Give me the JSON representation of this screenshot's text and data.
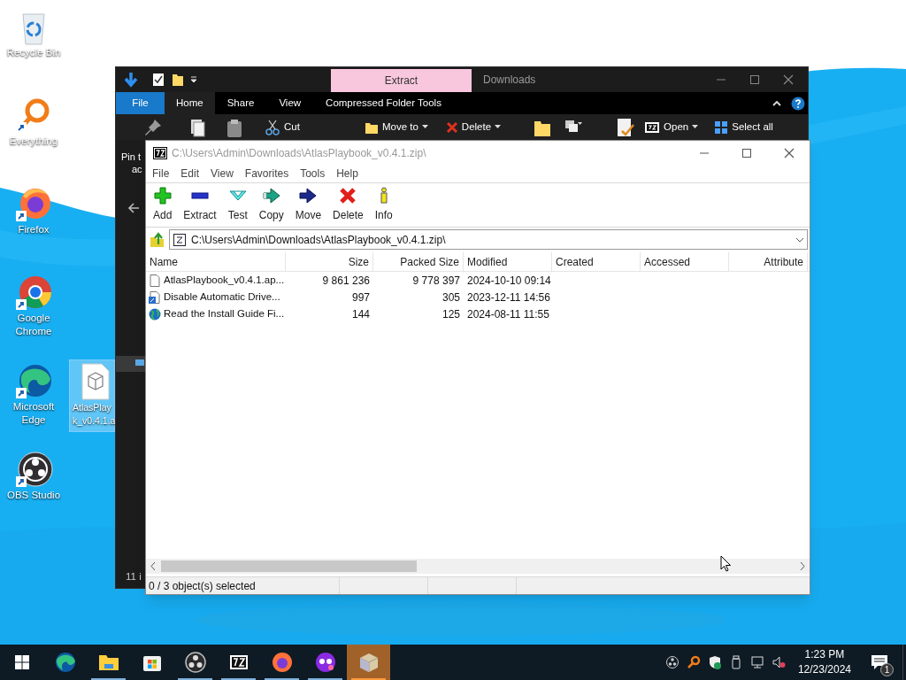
{
  "desktop": {
    "icons": [
      {
        "kind": "recycle-bin",
        "lines": [
          "Recycle Bin"
        ],
        "selected": false
      },
      {
        "kind": "everything",
        "lines": [
          "Everything"
        ],
        "selected": false
      },
      {
        "kind": "firefox",
        "lines": [
          "Firefox"
        ],
        "selected": false
      },
      {
        "kind": "chrome",
        "lines": [
          "Google",
          "Chrome"
        ],
        "selected": false
      },
      {
        "kind": "edge",
        "lines": [
          "Microsoft",
          "Edge"
        ],
        "selected": false
      },
      {
        "kind": "obs",
        "lines": [
          "OBS Studio"
        ],
        "selected": false
      },
      {
        "kind": "archive",
        "lines": [
          "AtlasPlay",
          "k_v0.4.1.a"
        ],
        "selected": true
      }
    ]
  },
  "explorer": {
    "context_tab": "Extract",
    "title": "Downloads",
    "tabs": [
      {
        "label": "File",
        "kind": "file",
        "selected": false
      },
      {
        "label": "Home",
        "kind": "tab",
        "selected": true
      },
      {
        "label": "Share",
        "kind": "tab",
        "selected": false
      },
      {
        "label": "View",
        "kind": "tab",
        "selected": false
      },
      {
        "label": "Compressed Folder Tools",
        "kind": "tab",
        "selected": false
      }
    ],
    "ribbon": [
      {
        "kind": "pin"
      },
      {
        "kind": "copy"
      },
      {
        "kind": "paste"
      },
      {
        "kind": "cut",
        "label": "Cut"
      },
      {
        "kind": "move",
        "label": "Move to"
      },
      {
        "kind": "delete",
        "label": "Delete"
      },
      {
        "kind": "folder"
      },
      {
        "kind": "copy-path"
      },
      {
        "kind": "properties"
      },
      {
        "kind": "open",
        "label": "Open"
      },
      {
        "kind": "select",
        "label": "Select all"
      }
    ],
    "pin_label_lines": [
      "Pin t",
      "ac"
    ],
    "status": "11 i"
  },
  "archive_window": {
    "title": "C:\\Users\\Admin\\Downloads\\AtlasPlaybook_v0.4.1.zip\\",
    "menu": [
      "File",
      "Edit",
      "View",
      "Favorites",
      "Tools",
      "Help"
    ],
    "toolbar": [
      {
        "kind": "add",
        "label": "Add"
      },
      {
        "kind": "extract",
        "label": "Extract"
      },
      {
        "kind": "test",
        "label": "Test"
      },
      {
        "kind": "copy",
        "label": "Copy"
      },
      {
        "kind": "move",
        "label": "Move"
      },
      {
        "kind": "delete",
        "label": "Delete"
      },
      {
        "kind": "info",
        "label": "Info"
      }
    ],
    "address": "C:\\Users\\Admin\\Downloads\\AtlasPlaybook_v0.4.1.zip\\",
    "columns": [
      "Name",
      "Size",
      "Packed Size",
      "Modified",
      "Created",
      "Accessed",
      "Attribute"
    ],
    "rows": [
      {
        "kind": "file",
        "cells": [
          "AtlasPlaybook_v0.4.1.ap...",
          "9 861 236",
          "9 778 397",
          "2024-10-10 09:14",
          "",
          "",
          ""
        ]
      },
      {
        "kind": "script",
        "cells": [
          "Disable Automatic Drive...",
          "997",
          "305",
          "2023-12-11 14:56",
          "",
          "",
          ""
        ]
      },
      {
        "kind": "globe",
        "cells": [
          "Read the Install Guide Fi...",
          "144",
          "125",
          "2024-08-11 11:55",
          "",
          "",
          ""
        ]
      }
    ],
    "status": "0 / 3 object(s) selected"
  },
  "taskbar": {
    "apps": [
      {
        "kind": "start",
        "running": false,
        "selected": false
      },
      {
        "kind": "edge",
        "running": false,
        "selected": false
      },
      {
        "kind": "explorer",
        "running": true,
        "selected": false
      },
      {
        "kind": "store",
        "running": false,
        "selected": false
      },
      {
        "kind": "obs",
        "running": true,
        "selected": false
      },
      {
        "kind": "sevenzip",
        "running": true,
        "selected": false
      },
      {
        "kind": "firefox",
        "running": true,
        "selected": false
      },
      {
        "kind": "mask",
        "running": true,
        "selected": false
      },
      {
        "kind": "box",
        "running": true,
        "selected": true
      }
    ],
    "tray": [
      {
        "kind": "obs"
      },
      {
        "kind": "everything"
      },
      {
        "kind": "shield"
      },
      {
        "kind": "usb"
      },
      {
        "kind": "network"
      },
      {
        "kind": "volume-muted"
      }
    ],
    "time": "1:23 PM",
    "date": "12/23/2024",
    "notifications": "1"
  }
}
